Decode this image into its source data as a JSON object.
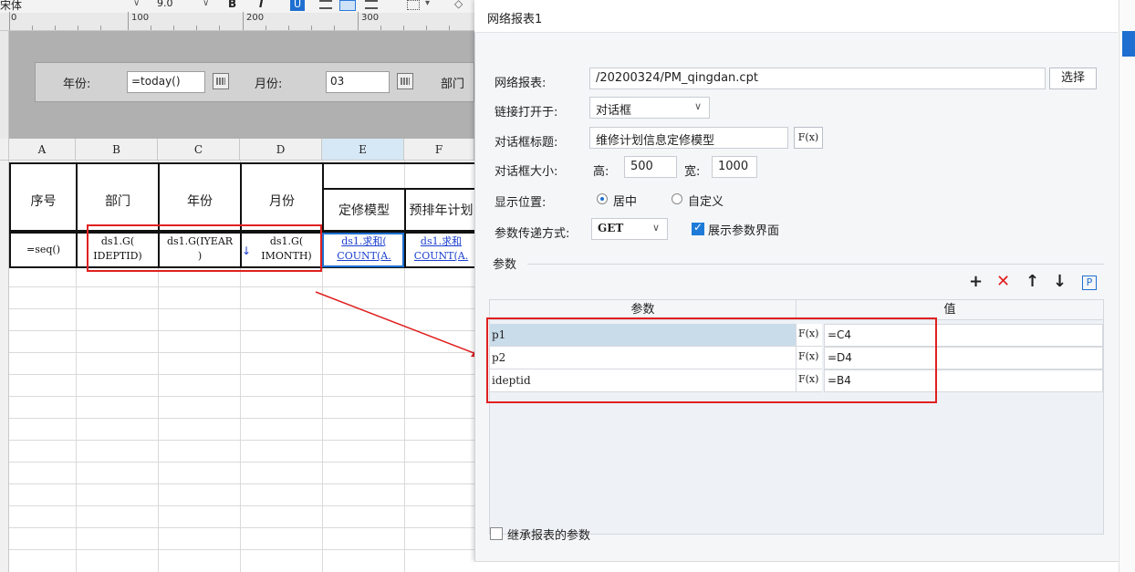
{
  "toolbar": {
    "font_name": "宋体",
    "font_size": "9.0",
    "bold": "B",
    "italic": "I",
    "underline": "U"
  },
  "ruler": {
    "marks": [
      "0",
      "100",
      "200",
      "300"
    ]
  },
  "param_pane": {
    "year_label": "年份:",
    "year_value": "=today()",
    "month_label": "月份:",
    "month_value": "03",
    "dept_label": "部门"
  },
  "sheet": {
    "columns": [
      "A",
      "B",
      "C",
      "D",
      "E",
      "F"
    ],
    "headers": {
      "a": "序号",
      "b": "部门",
      "c": "年份",
      "d": "月份",
      "e": "定修模型",
      "f": "预排年计划"
    },
    "row4": {
      "a": "=seq()",
      "b_line1": "ds1.G(",
      "b_line2": "IDEPTID)",
      "c_line1": "ds1.G(IYEAR",
      "c_line2": ")",
      "d_line1": "ds1.G(",
      "d_line2": "IMONTH)",
      "e_line1": "ds1.求和(",
      "e_line2": "COUNT(A.",
      "f_line1": "ds1.求和",
      "f_line2": "COUNT(A."
    }
  },
  "dialog": {
    "title": "网络报表1",
    "report_label": "网络报表:",
    "report_value": "/20200324/PM_qingdan.cpt",
    "choose_button": "选择",
    "open_label": "链接打开于:",
    "open_value": "对话框",
    "dialog_title_label": "对话框标题:",
    "dialog_title_value": "维修计划信息定修模型",
    "fx_label": "F(x)",
    "size_label": "对话框大小:",
    "height_label": "高:",
    "height_value": "500",
    "width_label": "宽:",
    "width_value": "1000",
    "position_label": "显示位置:",
    "position_center": "居中",
    "position_custom": "自定义",
    "method_label": "参数传递方式:",
    "method_value": "GET",
    "show_params_label": "展示参数界面",
    "params_section": "参数",
    "table_headers": {
      "param": "参数",
      "value": "值"
    },
    "params": [
      {
        "name": "p1",
        "fx": "F(x)",
        "value": "=C4"
      },
      {
        "name": "p2",
        "fx": "F(x)",
        "value": "=D4"
      },
      {
        "name": "ideptid",
        "fx": "F(x)",
        "value": "=B4"
      }
    ],
    "inherit_label": "继承报表的参数",
    "toolbar_icons": [
      "plus-icon",
      "delete-x-icon",
      "arrow-up-icon",
      "arrow-down-icon",
      "parameter-p-icon"
    ]
  },
  "colors": {
    "accent": "#1e6fd0",
    "highlight_red": "#e02020",
    "selected_row": "#c9dcea",
    "param_pane_bg": "#b0b0b0"
  }
}
